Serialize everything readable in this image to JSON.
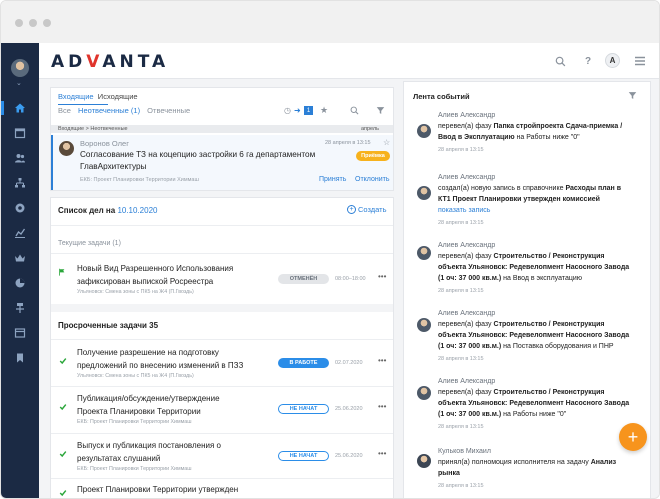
{
  "logo": {
    "text_a": "A",
    "text_d": "D",
    "text_v": "V",
    "text_rest": "ANTA"
  },
  "topbar": {
    "user_initial": "A"
  },
  "mail": {
    "tab_inbox": "Входящие",
    "tab_outbox": "Исходящие",
    "filter_all": "Все",
    "filter_unanswered": "Неотвеченные",
    "filter_unanswered_count": "(1)",
    "filter_answered": "Отвеченные",
    "counter": "1",
    "breadcrumb": "Входящие > Неотвеченные",
    "breadcrumb_month": "апрель",
    "message": {
      "sender": "Воронов Олег",
      "date": "28 апреля в 13:15",
      "subject_line1": "Согласование ТЗ на коцепцию застройки 6 га департаментом",
      "subject_line2": "ГлавАрхитектуры",
      "project": "ЕКБ: Проект Планировки Территории Химмаш",
      "status": "Приёмка",
      "accept": "Принять",
      "decline": "Отклонить"
    }
  },
  "tasks": {
    "title": "Список дел на",
    "date": "10.10.2020",
    "create": "Создать",
    "current_label": "Текущие задачи (1)",
    "current": [
      {
        "title_line1": "Новый Вид Разрешенного Использования",
        "title_line2": "зафиксирован выпиской Росреестра",
        "project": "Ульяновск: Смена зоны с ПК5 на Ж4 (П.Гвоздь)",
        "status": "ОТМЕНЁН",
        "time": "08:00–18:00"
      }
    ],
    "overdue_label": "Просроченные задачи 35",
    "overdue": [
      {
        "title_line1": "Получение разрешение на подготовку",
        "title_line2": "предложений по внесению изменений в ПЗЗ",
        "project": "Ульяновск: Смена зоны с ПК5 на Ж4 (П.Гвоздь)",
        "status": "В РАБОТЕ",
        "date": "02.07.2020"
      },
      {
        "title_line1": "Публикация/обсуждение/утверждение",
        "title_line2": "Проекта Планировки Территории",
        "project": "ЕКБ: Проект Планировки Территории Химмаш",
        "status": "НЕ НАЧАТ",
        "date": "25.06.2020"
      },
      {
        "title_line1": "Выпуск и публикация постановления о",
        "title_line2": "результатах слушаний",
        "project": "ЕКБ: Проект Планировки Территории Химмаш",
        "status": "НЕ НАЧАТ",
        "date": "25.06.2020"
      },
      {
        "title_line1": "Проект Планировки Территории утвержден",
        "title_line2": "",
        "project": "",
        "status": "",
        "date": ""
      }
    ]
  },
  "feed": {
    "title": "Лента событий",
    "items": [
      {
        "author": "Алиев Александр",
        "line1_pre": "перевел(а) фазу ",
        "line1_bold": "Папка стройпроекта Сдача-приемка /",
        "line2_bold": "Ввод в Эксплуатацию",
        "line2_post": " на Работы ниже \"0\"",
        "line3": "",
        "date": "28 апреля в 13:15"
      },
      {
        "author": "Алиев Александр",
        "line1_pre": "создал(а) новую запись в справочнике ",
        "line1_bold": "Расходы план в",
        "line2_bold": "КТ1 Проект Планировки утвержден комиссией",
        "line2_post": "",
        "line3": "показать запись",
        "date": "28 апреля в 13:15"
      },
      {
        "author": "Алиев Александр",
        "line1_pre": "перевел(а) фазу ",
        "line1_bold": "Строительство / Реконструкция",
        "line2_bold": "объекта Ульяновск: Редевелопмент Насосного Завода",
        "line3_bold": "(1 оч: 37 000 кв.м.)",
        "line3_post": " на Ввод в эксплуатацию",
        "date": "28 апреля в 13:15"
      },
      {
        "author": "Алиев Александр",
        "line1_pre": "перевел(а) фазу ",
        "line1_bold": "Строительство / Реконструкция",
        "line2_bold": "объекта Ульяновск: Редевелопмент Насосного Завода",
        "line3_bold": "(1 оч: 37 000 кв.м.)",
        "line3_post": " на Поставка оборудования и ПНР",
        "date": "28 апреля в 13:15"
      },
      {
        "author": "Алиев Александр",
        "line1_pre": "перевел(а) фазу ",
        "line1_bold": "Строительство / Реконструкция",
        "line2_bold": "объекта Ульяновск: Редевелопмент Насосного Завода",
        "line3_bold": "(1 оч: 37 000 кв.м.)",
        "line3_post": " на Работы ниже \"0\"",
        "date": "28 апреля в 13:15"
      },
      {
        "author": "Кульков Михаил",
        "line1_pre": "принял(а) полномоция исполнителя на задачу ",
        "line1_bold": "Анализ",
        "line2_bold": "рынка",
        "line2_post": "",
        "line3": "",
        "date": "28 апреля в 13:15"
      }
    ]
  },
  "colors": {
    "sidebar": "#1b2a44",
    "accent_blue": "#2b7fd6",
    "accent_orange": "#f7941d",
    "logo_red": "#e0342c"
  }
}
